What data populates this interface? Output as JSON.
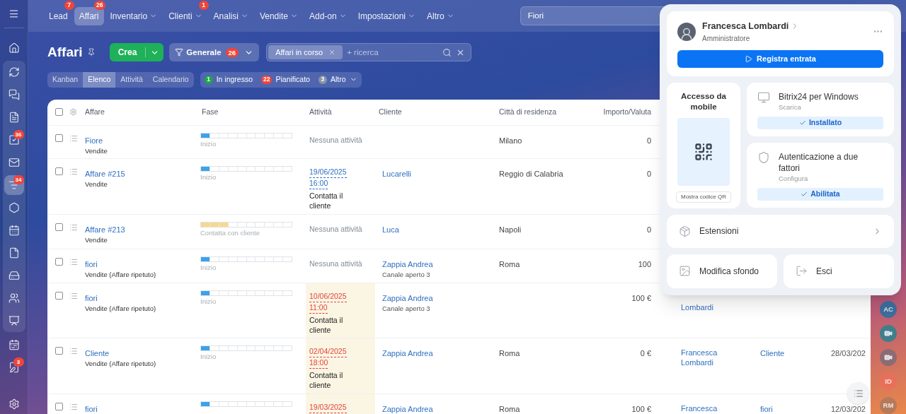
{
  "sidebar": {
    "items": [
      {
        "selected": false
      },
      {
        "selected": false
      },
      {
        "selected": false
      },
      {
        "selected": false
      },
      {
        "badge": "36",
        "selected": false
      },
      {
        "selected": false
      },
      {
        "badge": "34",
        "selected": true
      },
      {
        "selected": false
      },
      {
        "selected": false
      },
      {
        "selected": false
      },
      {
        "selected": false
      },
      {
        "selected": false
      },
      {
        "selected": false
      },
      {
        "selected": false
      },
      {
        "badge": "3",
        "selected": false
      },
      {
        "selected": false
      }
    ]
  },
  "top_nav": {
    "items": [
      {
        "label": "Lead",
        "badge": "7",
        "selected": false,
        "dropdown": false
      },
      {
        "label": "Affari",
        "badge": "26",
        "selected": true,
        "dropdown": false
      },
      {
        "label": "Inventario",
        "selected": false,
        "dropdown": true
      },
      {
        "label": "Clienti",
        "badge": "1",
        "selected": false,
        "dropdown": true
      },
      {
        "label": "Analisi",
        "selected": false,
        "dropdown": true
      },
      {
        "label": "Vendite",
        "selected": false,
        "dropdown": true
      },
      {
        "label": "Add-on",
        "selected": false,
        "dropdown": true
      },
      {
        "label": "Impostazioni",
        "selected": false,
        "dropdown": true
      },
      {
        "label": "Altro",
        "selected": false,
        "dropdown": true
      }
    ],
    "search": {
      "value": "Fiori"
    }
  },
  "page": {
    "title": "Affari",
    "create_button": "Crea",
    "filter_button": {
      "label": "Generale",
      "badge": "26"
    },
    "search": {
      "chip": "Affari in corso",
      "placeholder": "+ ricerca"
    },
    "views": [
      {
        "label": "Kanban",
        "selected": false
      },
      {
        "label": "Elenco",
        "selected": true
      },
      {
        "label": "Attività",
        "selected": false
      },
      {
        "label": "Calendario",
        "selected": false
      }
    ],
    "counters": [
      {
        "count": "1",
        "label": "In ingresso",
        "color": "#1fa64a",
        "dropdown": false
      },
      {
        "count": "22",
        "label": "Pianificato",
        "color": "#f0453a",
        "dropdown": false
      },
      {
        "count": "3",
        "label": "Altro",
        "color": "#8a94a6",
        "dropdown": true
      }
    ]
  },
  "table": {
    "all_checked": false,
    "columns": [
      "Affare",
      "Fase",
      "Attività",
      "Cliente",
      "Città di residenza",
      "Importo/Valuta"
    ],
    "rows": [
      {
        "checked": false,
        "title": "Fiore",
        "subtitle": "Vendite",
        "stage": {
          "label": "Inizio",
          "level": 0.1,
          "color": "#3aa3ea"
        },
        "activity": {
          "kind": "none",
          "text": "Nessuna attività"
        },
        "city": "Milano",
        "amount": "0"
      },
      {
        "checked": false,
        "title": "Affare #215",
        "subtitle": "Vendite",
        "stage": {
          "label": "Inizio",
          "level": 0.1,
          "color": "#3aa3ea"
        },
        "activity": {
          "kind": "task",
          "date": "19/06/2025",
          "time": "16:00",
          "text": "Contatta il cliente",
          "overdue": false
        },
        "client": {
          "name": "Lucarelli"
        },
        "city": "Reggio di Calabria",
        "amount": "0"
      },
      {
        "checked": false,
        "title": "Affare #213",
        "subtitle": "Vendite",
        "stage": {
          "label": "Contatta con cliente",
          "level": 0.3,
          "color": "#f8d98a"
        },
        "activity": {
          "kind": "none",
          "text": "Nessuna attività"
        },
        "client": {
          "name": "Luca"
        },
        "city": "Napoli",
        "amount": "0"
      },
      {
        "checked": false,
        "title": "fiori",
        "subtitle": "Vendite (Affare ripetuto)",
        "stage": {
          "label": "Inizio",
          "level": 0.1,
          "color": "#3aa3ea"
        },
        "activity": {
          "kind": "none",
          "text": "Nessuna attività"
        },
        "client": {
          "name": "Zappia Andrea",
          "note": "Canale aperto 3"
        },
        "city": "Roma",
        "amount": "100"
      },
      {
        "checked": false,
        "title": "fiori",
        "subtitle": "Vendite (Affare ripetuto)",
        "stage": {
          "label": "Inizio",
          "level": 0.1,
          "color": "#3aa3ea"
        },
        "activity": {
          "kind": "task",
          "date": "10/06/2025",
          "time": "11:00",
          "text": "Contatta il cliente",
          "overdue": true
        },
        "client": {
          "name": "Zappia Andrea",
          "note": "Canale aperto 3"
        },
        "amount": "100 €",
        "owner": {
          "lines": [
            "Lombardi"
          ],
          "first_line_hidden": true
        }
      },
      {
        "checked": false,
        "title": "Cliente",
        "subtitle": "Vendite (Affare ripetuto)",
        "stage": {
          "label": "Inizio",
          "level": 0.1,
          "color": "#3aa3ea"
        },
        "activity": {
          "kind": "task",
          "date": "02/04/2025",
          "time": "18:00",
          "text": "Contatta il cliente",
          "overdue": true
        },
        "client": {
          "name": "Zappia Andrea"
        },
        "city": "Roma",
        "amount": "0 €",
        "owner": {
          "lines": [
            "Francesca",
            "Lombardi"
          ]
        },
        "column_7": "Cliente",
        "column_8": "28/03/202"
      },
      {
        "checked": false,
        "title": "fiori",
        "stage": {
          "level": 0.1,
          "color": "#3aa3ea"
        },
        "activity": {
          "kind": "task",
          "date": "19/03/2025",
          "overdue": true
        },
        "client": {
          "name": "Zappia Andrea"
        },
        "city": "Roma",
        "amount": "100 €",
        "owner": {
          "lines": [
            "Francesca"
          ]
        },
        "column_7": "fiori",
        "column_8": "12/03/202"
      }
    ]
  },
  "profile_menu": {
    "name": "Francesca Lombardi",
    "role": "Amministratore",
    "primary_button": "Registra entrata",
    "mobile": {
      "title": "Accesso da mobile",
      "button": "Mostra codice QR"
    },
    "cards": [
      {
        "kind": "desktop",
        "title": "Bitrix24 per Windows",
        "subtitle": "Scarica",
        "status": "Installato"
      },
      {
        "kind": "security",
        "title": "Autenticazione a due fattori",
        "subtitle": "Configura",
        "status": "Abilitata"
      }
    ],
    "extensions": "Estensioni",
    "actions": [
      {
        "kind": "background",
        "label": "Modifica sfondo"
      },
      {
        "kind": "logout",
        "label": "Esci"
      }
    ]
  },
  "right_panel": {
    "items": [
      {
        "kind": "initials",
        "text": "AC",
        "color": "#3d6e9e"
      },
      {
        "kind": "video",
        "color": "#3f7f8c"
      },
      {
        "kind": "video",
        "color": "#8b6c74"
      },
      {
        "kind": "initials",
        "text": "ID",
        "color": "#e8705a"
      },
      {
        "kind": "initials",
        "text": "RM",
        "color": "#b57a5a"
      }
    ]
  }
}
